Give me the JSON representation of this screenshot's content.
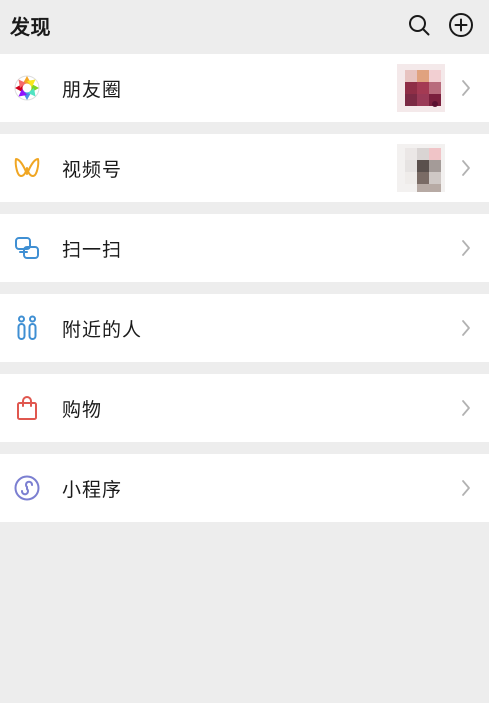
{
  "header": {
    "title": "发现",
    "search_icon": "search-icon",
    "add_icon": "add-circle-icon"
  },
  "items": [
    {
      "id": "moments",
      "label": "朋友圈",
      "icon": "moments-aperture-icon",
      "has_thumb": true
    },
    {
      "id": "channels",
      "label": "视频号",
      "icon": "channels-butterfly-icon",
      "has_thumb": true
    },
    {
      "id": "scan",
      "label": "扫一扫",
      "icon": "scan-icon",
      "has_thumb": false
    },
    {
      "id": "nearby",
      "label": "附近的人",
      "icon": "people-nearby-icon",
      "has_thumb": false
    },
    {
      "id": "shopping",
      "label": "购物",
      "icon": "shopping-bag-icon",
      "has_thumb": false
    },
    {
      "id": "miniprogram",
      "label": "小程序",
      "icon": "mini-program-icon",
      "has_thumb": false
    }
  ],
  "colors": {
    "background": "#ededed",
    "row": "#ffffff",
    "text": "#1a1a1a",
    "chevron": "#b2b2b2",
    "scan": "#3f8fd3",
    "nearby": "#3f8fd3",
    "shopping": "#e0574f",
    "miniprogram": "#7b7fd1",
    "channels": "#f0a623"
  }
}
